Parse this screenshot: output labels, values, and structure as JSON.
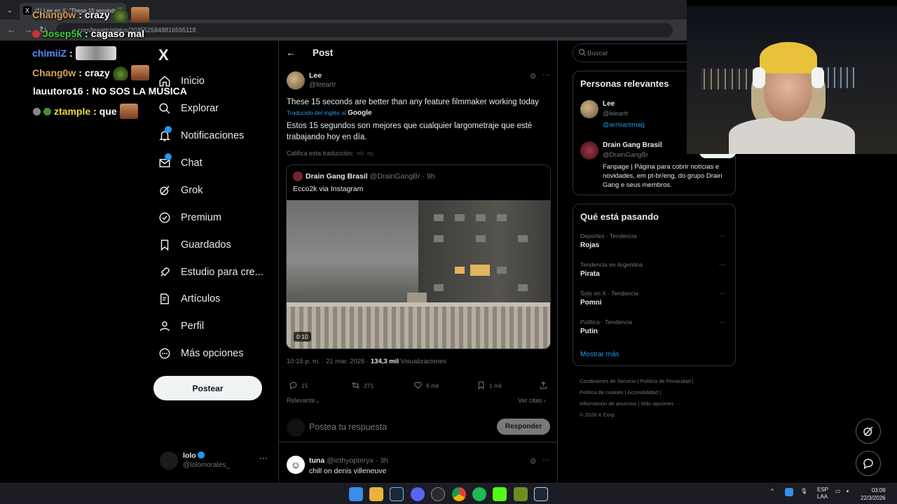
{
  "browser": {
    "tab_title": "(1) Lee en X: \"These 15 seconds",
    "url": "x.com/leeartr/status/2035525848816595118"
  },
  "chat": [
    {
      "user": "Chang0w",
      "user_color": "#d6a35a",
      "message": "crazy"
    },
    {
      "user": "Josep5k",
      "user_color": "#3fcf3f",
      "message": "cagaso mal"
    },
    {
      "user": "chimiiZ",
      "user_color": "#5a8fff",
      "message": ""
    },
    {
      "user": "Chang0w",
      "user_color": "#d6a35a",
      "message": "crazy"
    },
    {
      "user": "lauutoro16",
      "user_color": "#ffffff",
      "message": "NO SOS LA MUSICA"
    },
    {
      "user": "ztample",
      "user_color": "#e6d94a",
      "message": "que"
    }
  ],
  "nav": {
    "logo": "X",
    "items": [
      {
        "label": "Inicio",
        "icon": "home-icon"
      },
      {
        "label": "Explorar",
        "icon": "search-icon"
      },
      {
        "label": "Notificaciones",
        "icon": "bell-icon"
      },
      {
        "label": "Chat",
        "icon": "mail-icon"
      },
      {
        "label": "Grok",
        "icon": "grok-icon"
      },
      {
        "label": "Premium",
        "icon": "verified-icon"
      },
      {
        "label": "Guardados",
        "icon": "bookmark-icon"
      },
      {
        "label": "Estudio para cre...",
        "icon": "rocket-icon"
      },
      {
        "label": "Artículos",
        "icon": "article-icon"
      },
      {
        "label": "Perfil",
        "icon": "person-icon"
      },
      {
        "label": "Más opciones",
        "icon": "more-circle-icon"
      }
    ],
    "post_button": "Postear",
    "account": {
      "name": "lolo",
      "handle": "@lolomorales_"
    }
  },
  "post": {
    "header_title": "Post",
    "author_name": "Lee",
    "author_handle": "@leeartr",
    "text": "These 15 seconds are better than any feature filmmaker working today",
    "translated_label": "Traducido del inglés al",
    "translated_by": "Google",
    "translation": "Estos 15 segundos son mejores que cualquier largometraje que esté trabajando hoy en día.",
    "rate_translation": "Califica esta traducción:",
    "quote": {
      "name": "Drain Gang Brasil",
      "handle": "@DrainGangBr · 9h",
      "text": "Ecco2k via Instagram",
      "duration": "0:10"
    },
    "time": "10:15 p. m. · 21 mar. 2026 · ",
    "views": "134,3 mil",
    "views_label": " Visualizaciones",
    "replies": "15",
    "reposts": "271",
    "likes": "6 mil",
    "bookmarks": "1 mil",
    "sort_label": "Relevante",
    "quotes_link": "Ver citas",
    "reply_placeholder": "Postea tu respuesta",
    "reply_button": "Responder"
  },
  "reply": {
    "name": "tuna",
    "handle": "@icthyopteryx · 3h",
    "text": "chill on denis villeneuve"
  },
  "right": {
    "search_placeholder": "Buscar",
    "relevant_title": "Personas relevantes",
    "people": [
      {
        "name": "Lee",
        "handle": "@leeartr",
        "bio": "@arrivantmag"
      },
      {
        "name": "Drain Gang Brasil",
        "handle": "@DrainGangBr",
        "bio": "Fanpage | Página para cobrir notícias e novidades, em pt-br/eng, do grupo Drain Gang e seus membros."
      }
    ],
    "trending_title": "Qué está pasando",
    "trends": [
      {
        "category": "Deportes · Tendencia",
        "name": "Rojas"
      },
      {
        "category": "Tendencia en Argentina",
        "name": "Pirata"
      },
      {
        "category": "Solo en X · Tendencia",
        "name": "Pomni"
      },
      {
        "category": "Política · Tendencia",
        "name": "Putin"
      }
    ],
    "show_more": "Mostrar más",
    "footer": {
      "line1": "Condiciones de Servicio  |  Política de Privacidad  |",
      "line2": "Política de cookies  |  Accesibilidad  |",
      "line3": "Información de anuncios  |  Más opciones ···",
      "line4": "© 2026 X Corp."
    }
  },
  "taskbar": {
    "lang": "ESP",
    "lang2": "LAA",
    "time": "03:09",
    "date": "22/3/2026"
  }
}
